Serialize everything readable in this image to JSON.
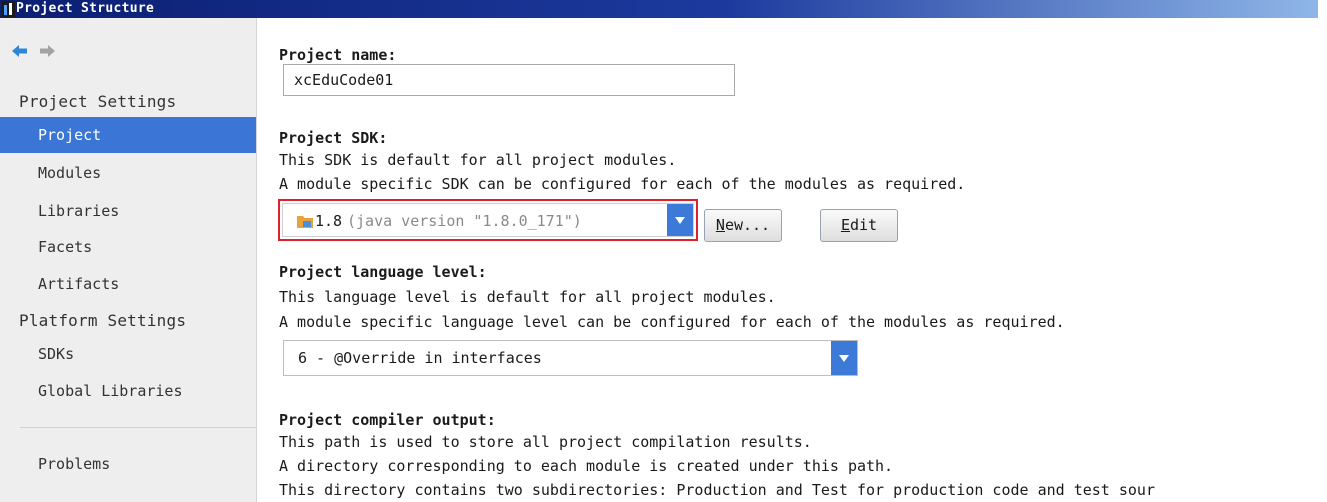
{
  "window": {
    "title": "Project Structure"
  },
  "sidebar": {
    "settings_header": "Project Settings",
    "settings_items": [
      "Project",
      "Modules",
      "Libraries",
      "Facets",
      "Artifacts"
    ],
    "selected": "Project",
    "platform_header": "Platform Settings",
    "platform_items": [
      "SDKs",
      "Global Libraries"
    ],
    "problems": "Problems"
  },
  "project": {
    "name_label": "Project name:",
    "name_value": "xcEduCode01",
    "sdk_label": "Project SDK:",
    "sdk_desc1": "This SDK is default for all project modules.",
    "sdk_desc2": "A module specific SDK can be configured for each of the modules as required.",
    "sdk_version": "1.8",
    "sdk_detail": "(java version \"1.8.0_171\")",
    "new_button_mnemonic": "N",
    "new_button_rest": "ew...",
    "edit_button_mnemonic": "E",
    "edit_button_rest": "dit",
    "lang_label": "Project language level:",
    "lang_desc1": "This language level is default for all project modules.",
    "lang_desc2": "A module specific language level can be configured for each of the modules as required.",
    "lang_value": "6 - @Override in interfaces",
    "compiler_label": "Project compiler output:",
    "compiler_desc1": "This path is used to store all project compilation results.",
    "compiler_desc2": "A directory corresponding to each module is created under this path.",
    "compiler_desc3": "This directory contains two subdirectories: Production and Test for production code and test sour"
  },
  "colors": {
    "selection": "#3b75d6",
    "highlight_box": "#e0202a",
    "combo_arrow": "#3d7ad8",
    "titlebar": "#0b1f72"
  },
  "icons": [
    "intellij-app-icon",
    "back-arrow-icon",
    "forward-arrow-icon",
    "sdk-folder-icon",
    "dropdown-arrow-icon"
  ]
}
